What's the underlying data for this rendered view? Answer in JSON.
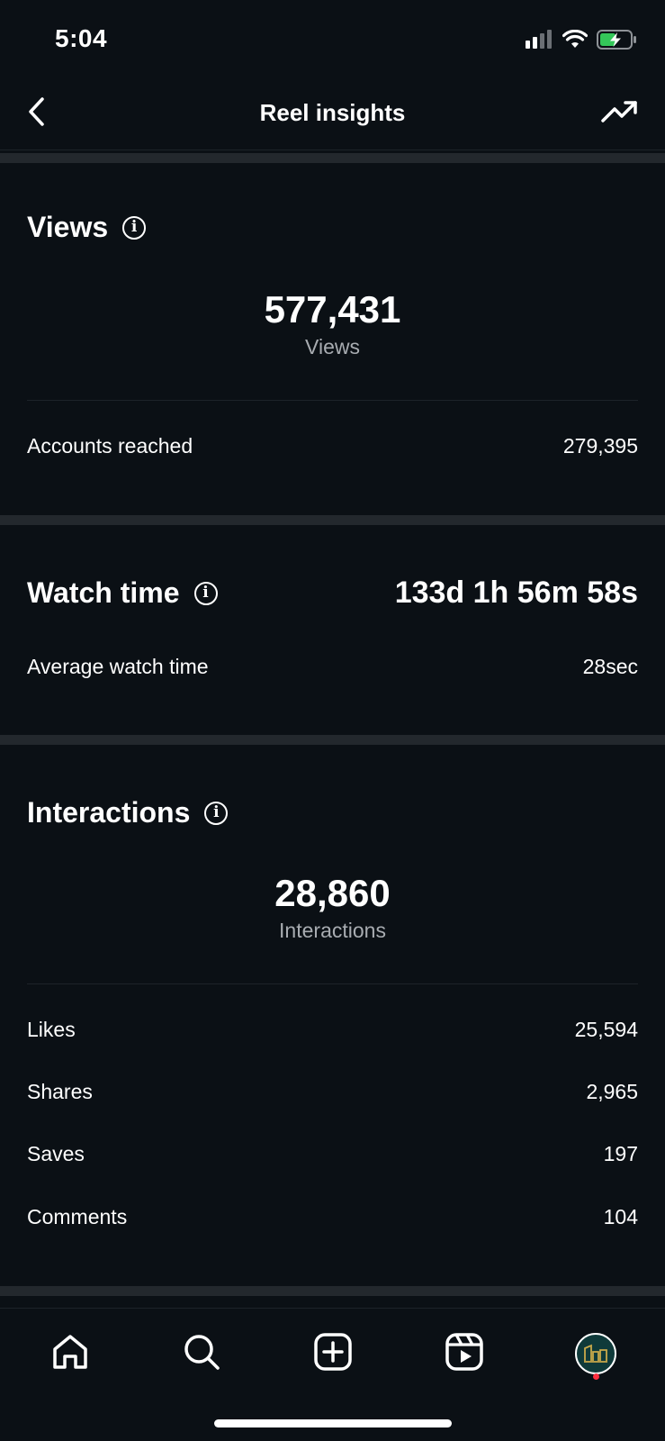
{
  "status_bar": {
    "time": "5:04"
  },
  "nav": {
    "title": "Reel insights"
  },
  "views": {
    "title": "Views",
    "total": "577,431",
    "total_label": "Views",
    "rows": [
      {
        "label": "Accounts reached",
        "value": "279,395"
      }
    ]
  },
  "watch_time": {
    "title": "Watch time",
    "total": "133d 1h 56m 58s",
    "rows": [
      {
        "label": "Average watch time",
        "value": "28sec"
      }
    ]
  },
  "interactions": {
    "title": "Interactions",
    "total": "28,860",
    "total_label": "Interactions",
    "rows": [
      {
        "label": "Likes",
        "value": "25,594"
      },
      {
        "label": "Shares",
        "value": "2,965"
      },
      {
        "label": "Saves",
        "value": "197"
      },
      {
        "label": "Comments",
        "value": "104"
      }
    ]
  },
  "tab_bar": {
    "items": [
      {
        "icon": "home-icon"
      },
      {
        "icon": "search-icon"
      },
      {
        "icon": "create-icon"
      },
      {
        "icon": "reels-icon"
      },
      {
        "icon": "profile-avatar"
      }
    ]
  },
  "colors": {
    "background": "#0b1015",
    "divider": "#23282d",
    "secondary_text": "#a8acb1",
    "battery": "#34c759",
    "notification": "#ff3040"
  }
}
